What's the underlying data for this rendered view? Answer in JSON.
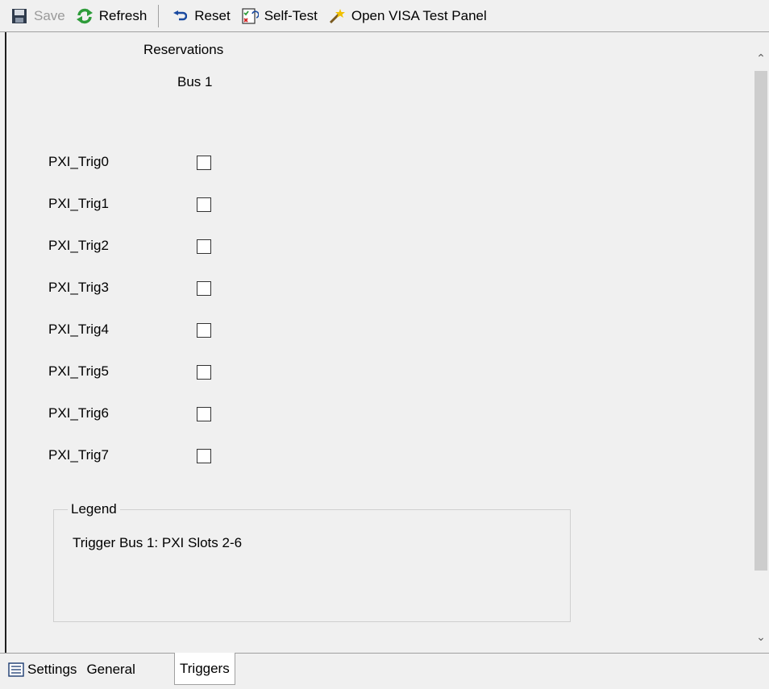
{
  "toolbar": {
    "save_label": "Save",
    "refresh_label": "Refresh",
    "reset_label": "Reset",
    "selftest_label": "Self-Test",
    "visa_label": "Open VISA Test Panel"
  },
  "main": {
    "reservations_header": "Reservations",
    "bus_header": "Bus 1",
    "triggers": [
      {
        "label": "PXI_Trig0",
        "checked": false
      },
      {
        "label": "PXI_Trig1",
        "checked": false
      },
      {
        "label": "PXI_Trig2",
        "checked": false
      },
      {
        "label": "PXI_Trig3",
        "checked": false
      },
      {
        "label": "PXI_Trig4",
        "checked": false
      },
      {
        "label": "PXI_Trig5",
        "checked": false
      },
      {
        "label": "PXI_Trig6",
        "checked": false
      },
      {
        "label": "PXI_Trig7",
        "checked": false
      }
    ],
    "legend": {
      "title": "Legend",
      "text": "Trigger Bus 1: PXI Slots 2-6"
    }
  },
  "tabs": [
    {
      "label": "Settings",
      "active": false
    },
    {
      "label": "General",
      "active": false
    },
    {
      "label": "Triggers",
      "active": true
    }
  ],
  "icons": {
    "save": "floppy-disk-icon",
    "refresh": "refresh-arrows-icon",
    "reset": "undo-arrow-icon",
    "selftest": "checklist-icon",
    "visa": "magic-wand-icon",
    "settings_tab": "list-icon"
  },
  "colors": {
    "refresh_green": "#2e9c3a",
    "reset_blue": "#1a4aa0",
    "wand_yellow": "#f0c000",
    "checkbox_border": "#333333"
  }
}
